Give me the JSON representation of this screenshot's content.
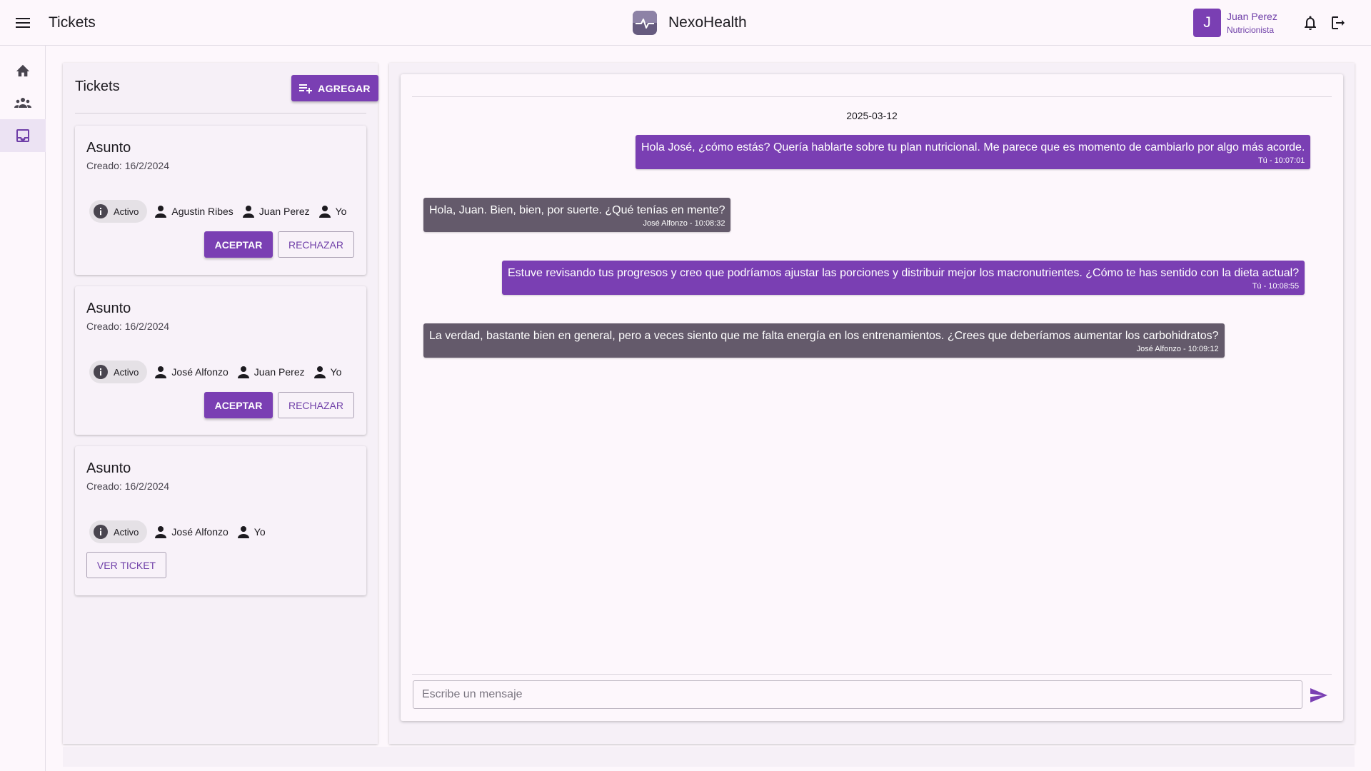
{
  "header": {
    "page_title": "Tickets",
    "brand_name": "NexoHealth",
    "user": {
      "initial": "J",
      "name": "Juan Perez",
      "role": "Nutricionista"
    }
  },
  "nav": {
    "items": [
      {
        "icon": "home-icon",
        "active": false
      },
      {
        "icon": "group-icon",
        "active": false
      },
      {
        "icon": "inbox-icon",
        "active": true
      }
    ]
  },
  "tickets": {
    "title": "Tickets",
    "add_label": "AGREGAR",
    "list": [
      {
        "subject": "Asunto",
        "created": "Creado: 16/2/2024",
        "status": "Activo",
        "people": [
          "Agustin Ribes",
          "Juan Perez",
          "Yo"
        ],
        "accept_label": "ACEPTAR",
        "reject_label": "RECHAZAR"
      },
      {
        "subject": "Asunto",
        "created": "Creado: 16/2/2024",
        "status": "Activo",
        "people": [
          "José Alfonzo",
          "Juan Perez",
          "Yo"
        ],
        "accept_label": "ACEPTAR",
        "reject_label": "RECHAZAR"
      },
      {
        "subject": "Asunto",
        "created": "Creado: 16/2/2024",
        "status": "Activo",
        "people": [
          "José Alfonzo",
          "Yo"
        ],
        "view_label": "VER TICKET"
      }
    ]
  },
  "chat": {
    "date": "2025-03-12",
    "messages": [
      {
        "from": "me",
        "text": "Hola José, ¿cómo estás? Quería hablarte sobre tu plan nutricional. Me parece que es momento de cambiarlo por algo más acorde.",
        "meta": "Tú - 10:07:01"
      },
      {
        "from": "them",
        "text": "Hola, Juan. Bien, bien, por suerte. ¿Qué tenías en mente?",
        "meta": "José Alfonzo - 10:08:32"
      },
      {
        "from": "me",
        "text": "Estuve revisando tus progresos y creo que podríamos ajustar las porciones y distribuir mejor los macronutrientes. ¿Cómo te has sentido con la dieta actual?",
        "meta": "Tú - 10:08:55"
      },
      {
        "from": "them",
        "text": "La verdad, bastante bien en general, pero a veces siento que me falta energía en los entrenamientos. ¿Crees que deberíamos aumentar los carbohidratos?",
        "meta": "José Alfonzo - 10:09:12"
      }
    ],
    "input_placeholder": "Escribe un mensaje",
    "input_value": ""
  },
  "colors": {
    "primary": "#7a3fb3",
    "incoming_bubble": "#645a6b",
    "background": "#fdf7fc"
  }
}
